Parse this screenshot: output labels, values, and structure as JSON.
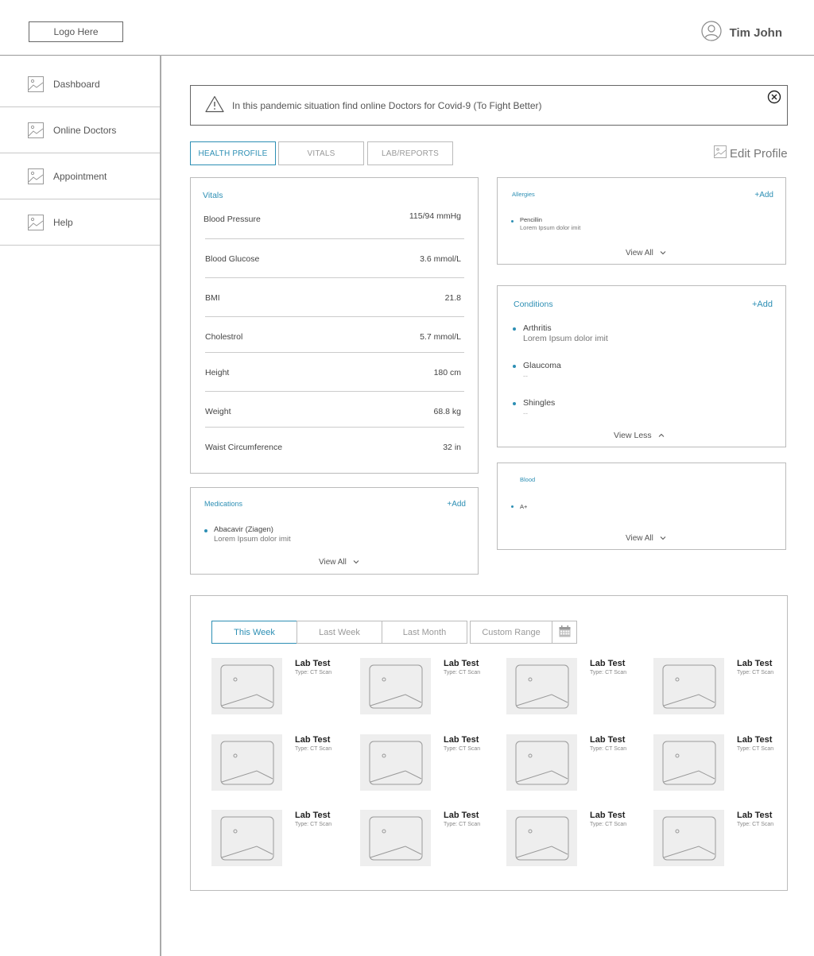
{
  "header": {
    "logo_text": "Logo Here",
    "user_name": "Tim John"
  },
  "sidebar": {
    "items": [
      {
        "label": "Dashboard",
        "icon": "image-icon"
      },
      {
        "label": "Online Doctors",
        "icon": "image-icon"
      },
      {
        "label": "Appointment",
        "icon": "image-icon"
      },
      {
        "label": "Help",
        "icon": "image-icon"
      }
    ]
  },
  "banner": {
    "text": "In this pandemic situation find online Doctors for Covid-9 (To Fight Better)",
    "icon": "warning-icon"
  },
  "tabs": [
    {
      "label": "HEALTH PROFILE",
      "active": true
    },
    {
      "label": "VITALS",
      "active": false
    },
    {
      "label": "LAB/REPORTS",
      "active": false
    }
  ],
  "edit_profile_label": "Edit Profile",
  "vitals": {
    "title": "Vitals",
    "rows": [
      {
        "label": "Blood Pressure",
        "value": "115/94 mmHg"
      },
      {
        "label": "Blood Glucose",
        "value": "3.6 mmol/L"
      },
      {
        "label": "BMI",
        "value": "21.8"
      },
      {
        "label": "Cholestrol",
        "value": "5.7 mmol/L"
      },
      {
        "label": "Height",
        "value": "180 cm"
      },
      {
        "label": "Weight",
        "value": "68.8 kg"
      },
      {
        "label": "Waist Circumference",
        "value": "32 in"
      }
    ]
  },
  "medications": {
    "title": "Medications",
    "add_label": "+Add",
    "items": [
      {
        "name": "Abacavir (Ziagen)",
        "sub": "Lorem Ipsum dolor imit"
      }
    ],
    "view_label": "View All"
  },
  "allergies": {
    "title": "Allergies",
    "add_label": "+Add",
    "items": [
      {
        "name": "Pencillin",
        "sub": "Lorem Ipsum dolor imit"
      }
    ],
    "view_label": "View All"
  },
  "conditions": {
    "title": "Conditions",
    "add_label": "+Add",
    "items": [
      {
        "name": "Arthritis",
        "sub": "Lorem Ipsum dolor imit"
      },
      {
        "name": "Glaucoma",
        "sub": "--"
      },
      {
        "name": "Shingles",
        "sub": "--"
      }
    ],
    "view_label": "View Less"
  },
  "blood": {
    "title": "Blood",
    "items": [
      {
        "name": "A+"
      }
    ],
    "view_label": "View All"
  },
  "lab": {
    "ranges": [
      {
        "label": "This Week",
        "active": true
      },
      {
        "label": "Last Week",
        "active": false
      },
      {
        "label": "Last Month",
        "active": false
      },
      {
        "label": "Custom  Range",
        "active": false
      }
    ],
    "calendar_icon": "calendar-icon",
    "items": [
      {
        "title": "Lab Test",
        "type": "Type: CT Scan"
      },
      {
        "title": "Lab Test",
        "type": "Type: CT Scan"
      },
      {
        "title": "Lab Test",
        "type": "Type: CT Scan"
      },
      {
        "title": "Lab Test",
        "type": "Type: CT Scan"
      },
      {
        "title": "Lab Test",
        "type": "Type: CT Scan"
      },
      {
        "title": "Lab Test",
        "type": "Type: CT Scan"
      },
      {
        "title": "Lab Test",
        "type": "Type: CT Scan"
      },
      {
        "title": "Lab Test",
        "type": "Type: CT Scan"
      },
      {
        "title": "Lab Test",
        "type": "Type: CT Scan"
      },
      {
        "title": "Lab Test",
        "type": "Type: CT Scan"
      },
      {
        "title": "Lab Test",
        "type": "Type: CT Scan"
      },
      {
        "title": "Lab Test",
        "type": "Type: CT Scan"
      }
    ]
  }
}
